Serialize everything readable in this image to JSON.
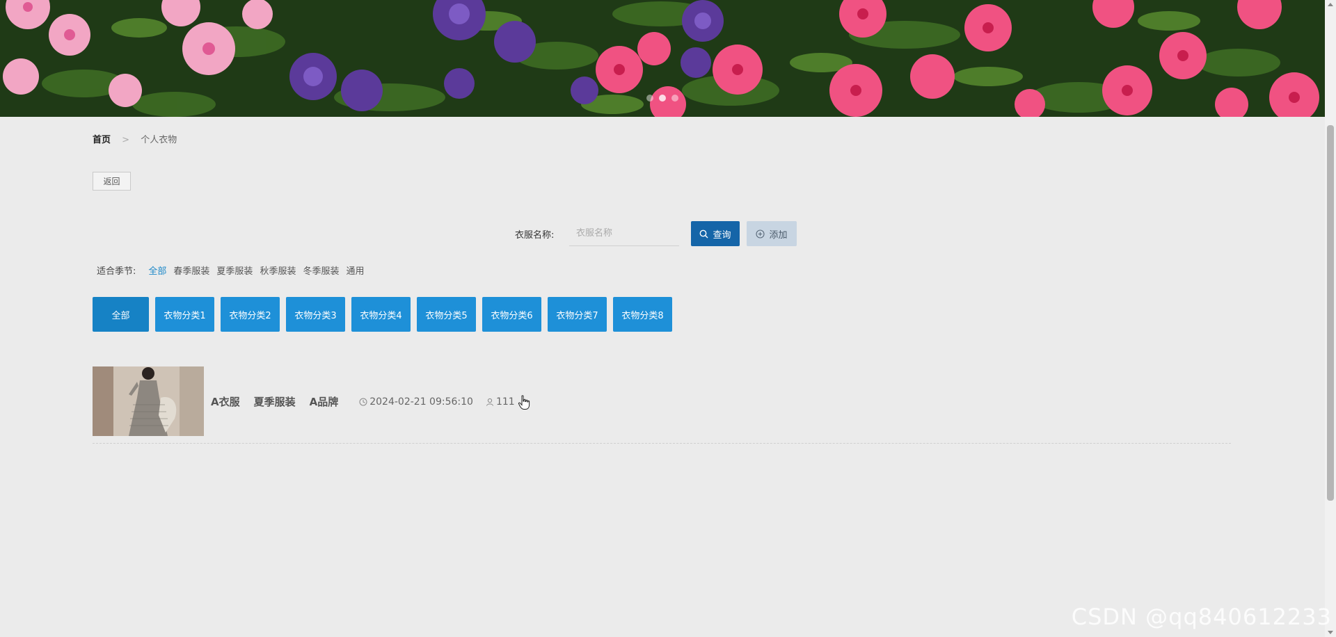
{
  "breadcrumb": {
    "home": "首页",
    "separator": ">",
    "current": "个人衣物"
  },
  "back_label": "返回",
  "search": {
    "label": "衣服名称:",
    "placeholder": "衣服名称",
    "value": "",
    "query_label": "查询",
    "add_label": "添加"
  },
  "season_filter": {
    "label": "适合季节:",
    "options": [
      "全部",
      "春季服装",
      "夏季服装",
      "秋季服装",
      "冬季服装",
      "通用"
    ],
    "selected": "全部"
  },
  "categories": [
    "全部",
    "衣物分类1",
    "衣物分类2",
    "衣物分类3",
    "衣物分类4",
    "衣物分类5",
    "衣物分类6",
    "衣物分类7",
    "衣物分类8"
  ],
  "items": [
    {
      "name": "A衣服",
      "season": "夏季服装",
      "brand": "A品牌",
      "time": "2024-02-21 09:56:10",
      "user": "111"
    }
  ],
  "watermark": "CSDN @qq840612233",
  "colors": {
    "primary": "#1565a8",
    "category": "#1e90d8",
    "link_active": "#1e88c8",
    "background": "#ebebeb"
  }
}
